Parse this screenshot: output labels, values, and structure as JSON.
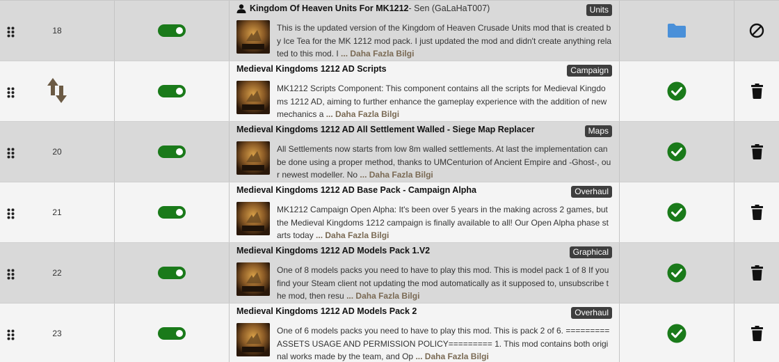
{
  "colors": {
    "toggle_on": "#1a7a1a",
    "status_ok": "#1a7a1a",
    "folder": "#4a90d9",
    "badge_bg": "#3e3e3e",
    "more_link": "#7a6a54"
  },
  "rows": [
    {
      "order": "18",
      "order_icon": null,
      "enabled": true,
      "title": "Kingdom Of Heaven Units For MK1212",
      "author": " - Sen (GaLaHaT007)",
      "owned": true,
      "category": "Units",
      "description": "This is the updated version of the Kingdom of Heaven Crusade Units mod that is created by Ice Tea for the MK 1212 mod pack.   I just updated the mod and didn't create anything related to this mod. I",
      "more_label": " ... Daha Fazla Bilgi",
      "status_icon": "folder-icon",
      "action_icon": "ban-icon"
    },
    {
      "order": "",
      "order_icon": "sort-arrows-icon",
      "enabled": true,
      "title": "Medieval Kingdoms 1212 AD Scripts",
      "author": "",
      "owned": false,
      "category": "Campaign",
      "description": "MK1212 Scripts Component: This component contains all the scripts for Medieval Kingdoms 1212 AD, aiming to further enhance the gameplay experience with the addition of new mechanics a",
      "more_label": " ... Daha Fazla Bilgi",
      "status_icon": "check-circle-icon",
      "action_icon": "trash-icon"
    },
    {
      "order": "20",
      "order_icon": null,
      "enabled": true,
      "title": "Medieval Kingdoms 1212 AD All Settlement Walled - Siege Map Replacer",
      "author": "",
      "owned": false,
      "category": "Maps",
      "description": "All Settlements now starts from low 8m walled settlements.  At last the implementation can be done using a proper method, thanks to UMCenturion of Ancient Empire and -Ghost-, our newest modeller. No",
      "more_label": " ... Daha Fazla Bilgi",
      "status_icon": "check-circle-icon",
      "action_icon": "trash-icon"
    },
    {
      "order": "21",
      "order_icon": null,
      "enabled": true,
      "title": "Medieval Kingdoms 1212 AD Base Pack - Campaign Alpha",
      "author": "",
      "owned": false,
      "category": "Overhaul",
      "description": "MK1212 Campaign Open Alpha: It's been over 5 years in the making across 2 games, but the Medieval Kingdoms 1212 campaign is finally available to all! Our Open Alpha phase starts today",
      "more_label": " ... Daha Fazla Bilgi",
      "status_icon": "check-circle-icon",
      "action_icon": "trash-icon"
    },
    {
      "order": "22",
      "order_icon": null,
      "enabled": true,
      "title": "Medieval Kingdoms 1212 AD Models Pack 1.V2",
      "author": "",
      "owned": false,
      "category": "Graphical",
      "description": "One of 8 models packs you need to have to play this mod. This is model pack 1 of 8  If you find your Steam client not updating the mod automatically as it supposed to, unsubscribe the mod, then resu",
      "more_label": " ... Daha Fazla Bilgi",
      "status_icon": "check-circle-icon",
      "action_icon": "trash-icon"
    },
    {
      "order": "23",
      "order_icon": null,
      "enabled": true,
      "title": "Medieval Kingdoms 1212 AD Models Pack 2",
      "author": "",
      "owned": false,
      "category": "Overhaul",
      "description": "One of 6 models packs you need to have to play this mod. This is pack 2 of 6.  ========= ASSETS USAGE AND PERMISSION POLICY========= 1. This mod contains both original works made by the team, and Op",
      "more_label": " ... Daha Fazla Bilgi",
      "status_icon": "check-circle-icon",
      "action_icon": "trash-icon"
    }
  ]
}
